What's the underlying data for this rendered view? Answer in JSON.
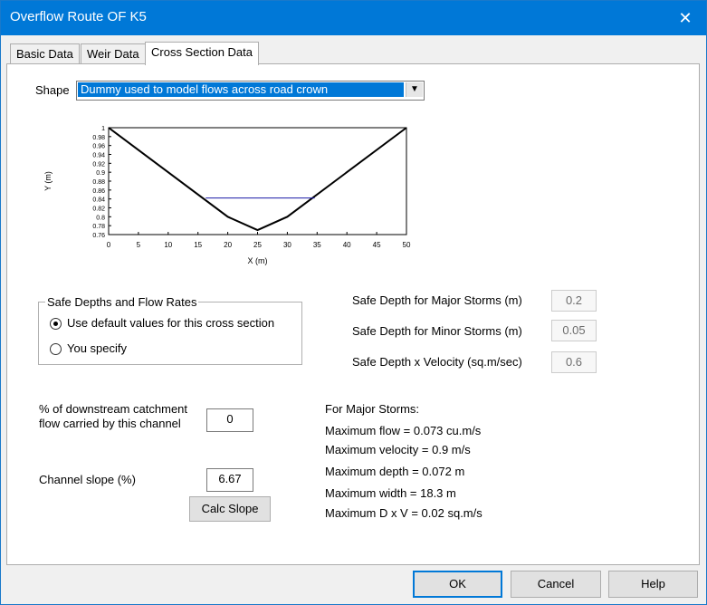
{
  "window": {
    "title": "Overflow Route OF K5",
    "close_glyph": "✕"
  },
  "tabs": [
    "Basic Data",
    "Weir Data",
    "Cross Section Data"
  ],
  "shape": {
    "label": "Shape",
    "selected": "Dummy used to model flows across road crown",
    "arrow": "▼"
  },
  "chart_data": {
    "type": "line",
    "xlabel": "X (m)",
    "ylabel": "Y (m)",
    "xlim": [
      0,
      50
    ],
    "ylim": [
      0.76,
      1
    ],
    "x_ticks": [
      "0",
      "5",
      "10",
      "15",
      "20",
      "25",
      "30",
      "35",
      "40",
      "45",
      "50"
    ],
    "y_ticks": [
      "0.76",
      "0.78",
      "0.8",
      "0.82",
      "0.84",
      "0.86",
      "0.88",
      "0.9",
      "0.92",
      "0.94",
      "0.96",
      "0.98",
      "1"
    ],
    "series": [
      {
        "x": [
          0,
          20,
          25,
          30,
          50
        ],
        "y": [
          1,
          0.8,
          0.77,
          0.8,
          1
        ],
        "color": "#000000"
      },
      {
        "x": [
          16.3,
          34.6
        ],
        "y": [
          0.842,
          0.842
        ],
        "color": "#1a1aa6"
      }
    ]
  },
  "safe_group": {
    "title": "Safe Depths and Flow Rates",
    "option_default": "Use default values for this cross section",
    "option_specify": "You specify"
  },
  "safe_fields": [
    {
      "label": "Safe Depth for Major Storms (m)",
      "value": "0.2"
    },
    {
      "label": "Safe Depth for Minor Storms (m)",
      "value": "0.05"
    },
    {
      "label": "Safe Depth x Velocity (sq.m/sec)",
      "value": "0.6"
    }
  ],
  "downstream": {
    "label": "% of downstream catchment flow carried by this channel",
    "value": "0"
  },
  "slope": {
    "label": "Channel slope (%)",
    "value": "6.67",
    "button": "Calc Slope"
  },
  "results": {
    "heading": "For Major Storms:",
    "lines": [
      "Maximum flow = 0.073 cu.m/s",
      "Maximum velocity = 0.9 m/s",
      "Maximum depth = 0.072 m",
      "Maximum width = 18.3 m",
      "Maximum D x V = 0.02 sq.m/s"
    ]
  },
  "buttons": {
    "ok": "OK",
    "cancel": "Cancel",
    "help": "Help"
  },
  "colors": {
    "titlebar": "#0078d7",
    "selection": "#0078d7",
    "water": "#1a1aa6"
  }
}
